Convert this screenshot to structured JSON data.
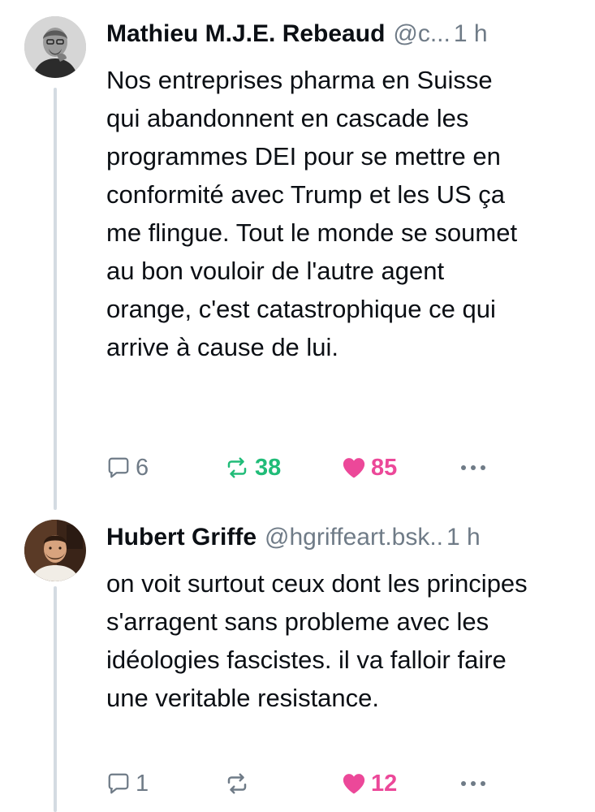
{
  "posts": [
    {
      "author_name": "Mathieu M.J.E. Rebeaud",
      "handle": "@c...",
      "time": "1 h",
      "text": "Nos entreprises pharma en Suisse qui abandonnent en cascade les programmes DEI pour se mettre en conformité avec Trump et les US ça me flingue. Tout le monde se soumet au bon vouloir de l'autre agent orange, c'est catastrophique ce qui arrive à cause de lui.",
      "replies": "6",
      "reposts": "38",
      "likes": "85",
      "reposted": true,
      "liked": true
    },
    {
      "author_name": "Hubert Griffe",
      "handle": "@hgriffeart.bsk..",
      "time": "1 h",
      "text": "on voit surtout ceux dont les principes s'arragent sans probleme avec les idéologies fascistes. il va falloir faire une veritable resistance.",
      "replies": "1",
      "reposts": "",
      "likes": "12",
      "reposted": false,
      "liked": true
    }
  ],
  "icons": {
    "reply": "speech-bubble-icon",
    "repost": "repost-arrows-icon",
    "like": "heart-icon",
    "more": "ellipsis-icon"
  },
  "colors": {
    "text": "#0b0f14",
    "muted": "#6f7b87",
    "repost_active": "#20bc78",
    "like_active": "#ec4899",
    "thread_line": "#d4dbe2"
  }
}
